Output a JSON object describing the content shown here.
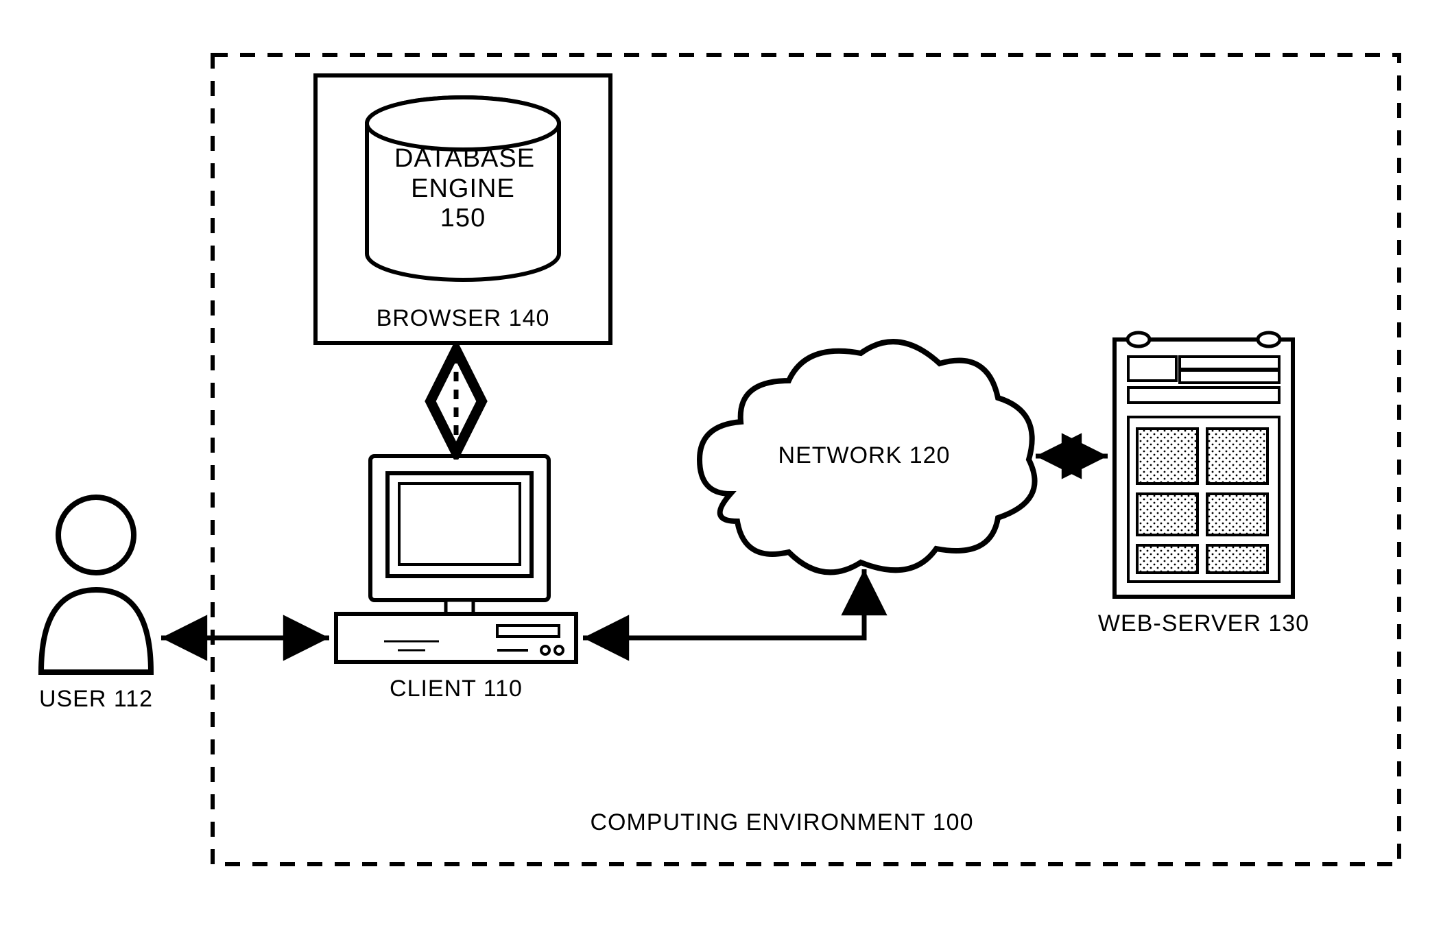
{
  "nodes": {
    "user": {
      "label": "USER 112"
    },
    "client": {
      "label": "CLIENT 110"
    },
    "browser": {
      "label": "BROWSER 140"
    },
    "database": {
      "label": "DATABASE\nENGINE\n150"
    },
    "network": {
      "label": "NETWORK 120"
    },
    "webserver": {
      "label": "WEB-SERVER 130"
    }
  },
  "container": {
    "label": "COMPUTING ENVIRONMENT 100"
  },
  "edges": [
    {
      "from": "user",
      "to": "client",
      "style": "solid",
      "bidir": true
    },
    {
      "from": "client",
      "to": "browser",
      "style": "dashed",
      "bidir": true
    },
    {
      "from": "client",
      "to": "network",
      "style": "solid",
      "bidir": true
    },
    {
      "from": "network",
      "to": "webserver",
      "style": "solid",
      "bidir": true
    }
  ]
}
